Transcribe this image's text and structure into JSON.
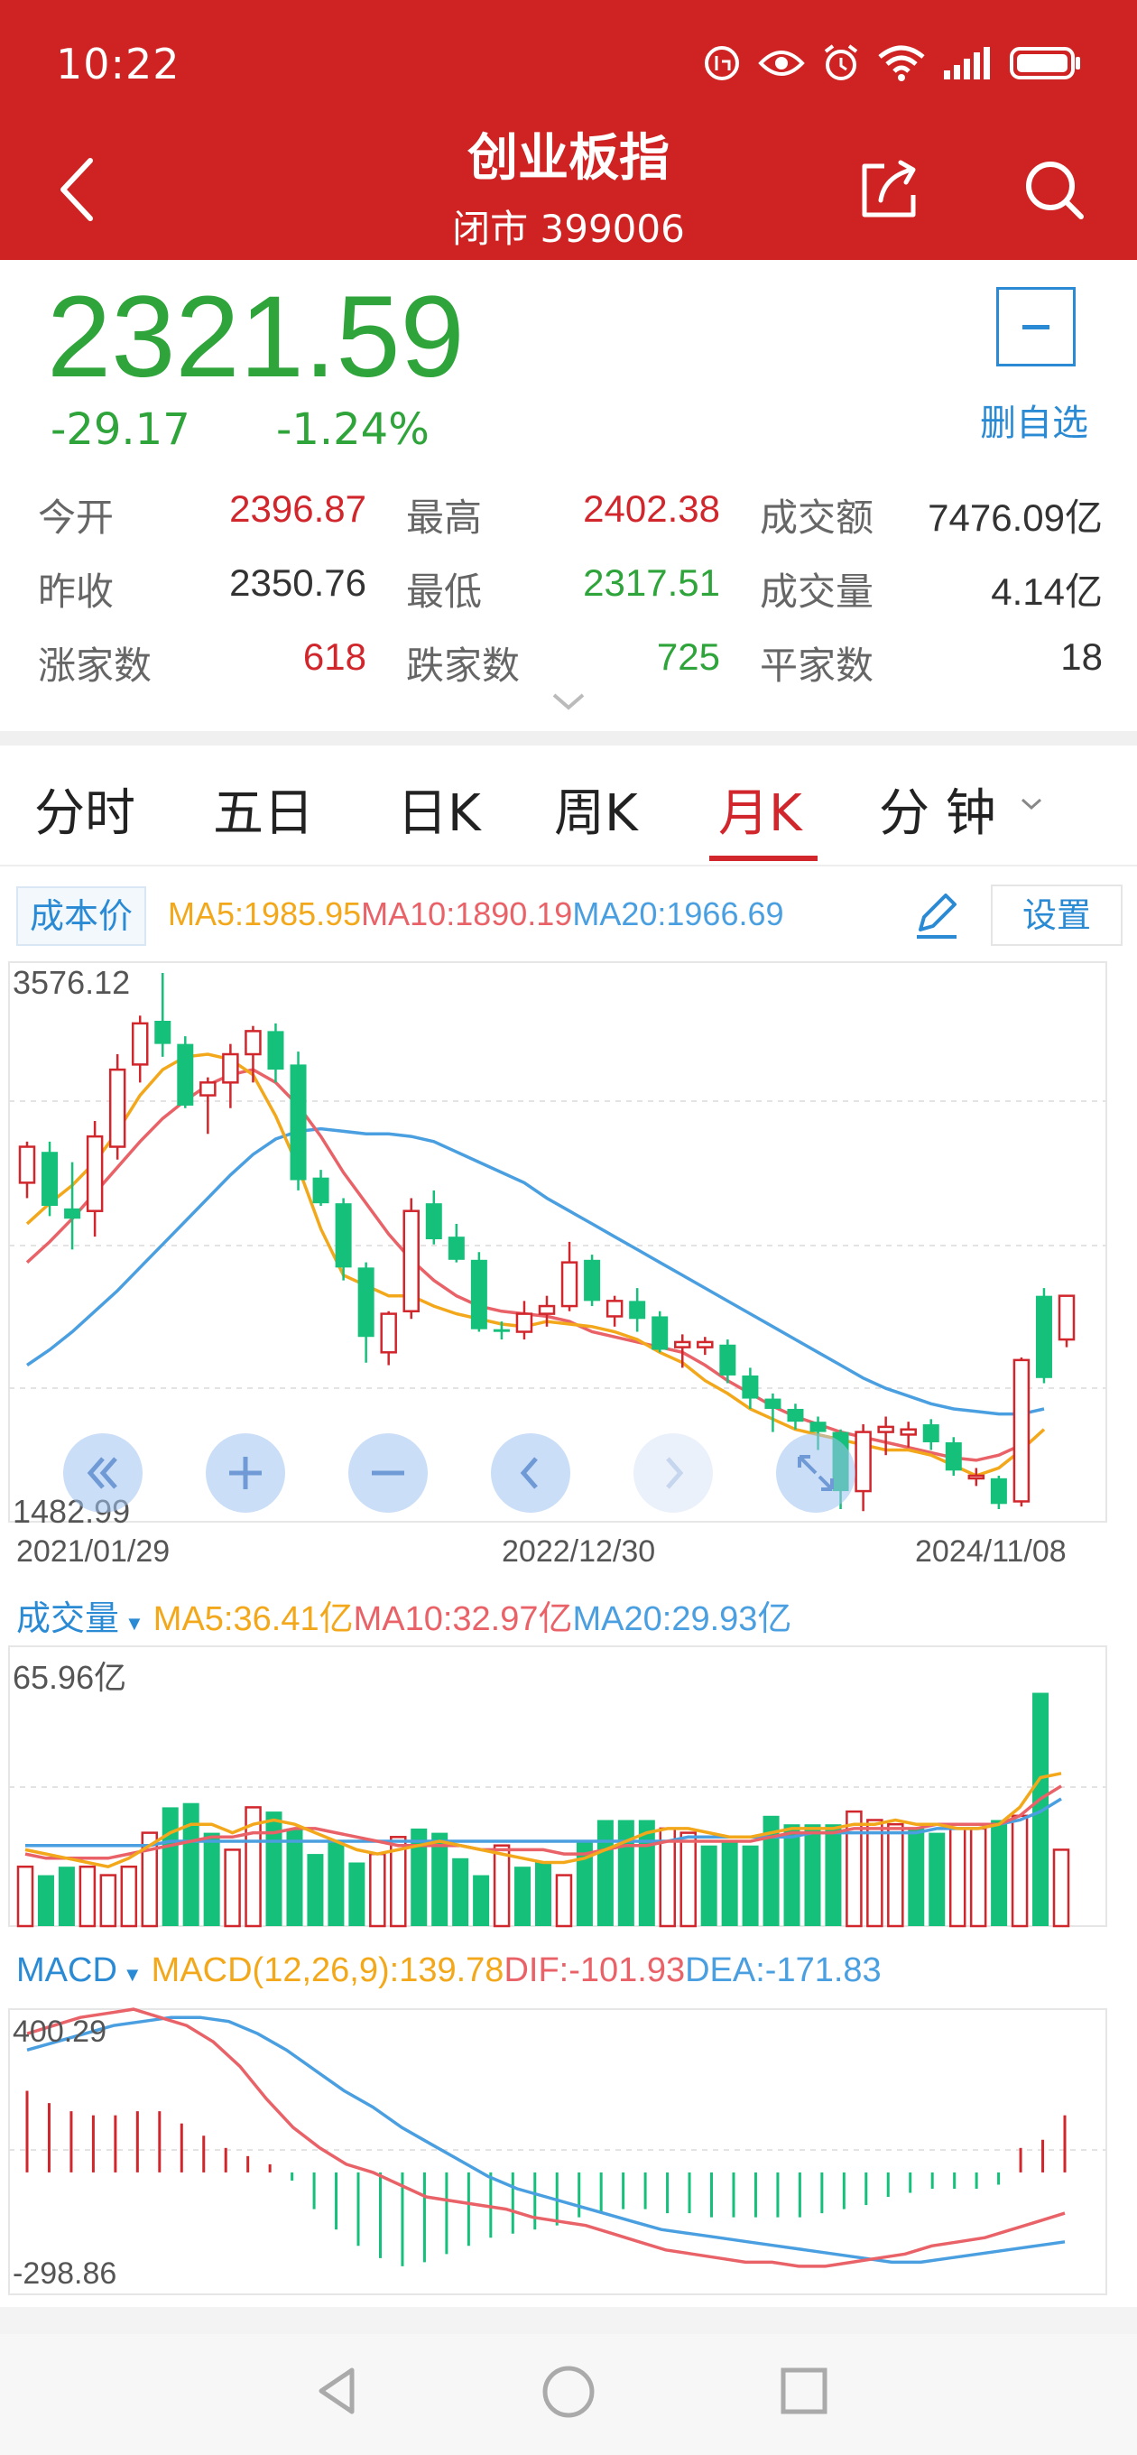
{
  "status_bar": {
    "time": "10:22"
  },
  "header": {
    "title": "创业板指",
    "subtitle": "闭市 399006"
  },
  "quote": {
    "price": "2321.59",
    "change": "-29.17",
    "change_pct": "-1.24%",
    "fav_label": "删自选"
  },
  "stats": [
    {
      "label": "今开",
      "value": "2396.87",
      "color": "red"
    },
    {
      "label": "最高",
      "value": "2402.38",
      "color": "red"
    },
    {
      "label": "成交额",
      "value": "7476.09亿",
      "color": "dark"
    },
    {
      "label": "昨收",
      "value": "2350.76",
      "color": "dark"
    },
    {
      "label": "最低",
      "value": "2317.51",
      "color": "green"
    },
    {
      "label": "成交量",
      "value": "4.14亿",
      "color": "dark"
    },
    {
      "label": "涨家数",
      "value": "618",
      "color": "red"
    },
    {
      "label": "跌家数",
      "value": "725",
      "color": "green"
    },
    {
      "label": "平家数",
      "value": "18",
      "color": "dark"
    }
  ],
  "tabs": [
    {
      "label": "分时"
    },
    {
      "label": "五日"
    },
    {
      "label": "日K"
    },
    {
      "label": "周K"
    },
    {
      "label": "月K",
      "active": true
    },
    {
      "label": "分 钟"
    }
  ],
  "main_chart": {
    "cost_chip": "成本价",
    "ma5": "MA5:1985.95",
    "ma10": "MA10:1890.19",
    "ma20": "MA20:1966.69",
    "settings": "设置",
    "y_max": "3576.12",
    "y_min": "1482.99",
    "dates": [
      "2021/01/29",
      "2022/12/30",
      "2024/11/08"
    ]
  },
  "volume_chart": {
    "title": "成交量",
    "ma5": "MA5:36.41亿",
    "ma10": "MA10:32.97亿",
    "ma20": "MA20:29.93亿",
    "y_max": "65.96亿"
  },
  "macd_chart": {
    "title": "MACD",
    "macd": "MACD(12,26,9):139.78",
    "dif": "DIF:-101.93",
    "dea": "DEA:-171.83",
    "y_max": "400.29",
    "y_min": "-298.86"
  },
  "colors": {
    "up": "#d0262c",
    "down": "#14c07a",
    "ma5": "#f2a81a",
    "ma10": "#e96268",
    "ma20": "#4a9fe0"
  },
  "chart_data": [
    {
      "type": "candlestick",
      "ylim": [
        1482.99,
        3576.12
      ],
      "ohlc": [
        [
          2900,
          2920,
          2700,
          2760,
          "up"
        ],
        [
          2880,
          2920,
          2630,
          2670,
          "down"
        ],
        [
          2660,
          2840,
          2500,
          2620,
          "down"
        ],
        [
          2650,
          3000,
          2550,
          2940,
          "up"
        ],
        [
          2900,
          3260,
          2850,
          3200,
          "up"
        ],
        [
          3220,
          3410,
          3150,
          3380,
          "up"
        ],
        [
          3390,
          3576,
          3250,
          3300,
          "down"
        ],
        [
          3300,
          3330,
          3050,
          3060,
          "down"
        ],
        [
          3100,
          3170,
          2950,
          3150,
          "up"
        ],
        [
          3150,
          3300,
          3050,
          3260,
          "up"
        ],
        [
          3260,
          3370,
          3150,
          3350,
          "up"
        ],
        [
          3350,
          3380,
          3150,
          3200,
          "down"
        ],
        [
          3220,
          3270,
          2730,
          2770,
          "down"
        ],
        [
          2780,
          2810,
          2670,
          2680,
          "down"
        ],
        [
          2680,
          2700,
          2380,
          2430,
          "down"
        ],
        [
          2430,
          2450,
          2060,
          2160,
          "down"
        ],
        [
          2100,
          2260,
          2050,
          2250,
          "up"
        ],
        [
          2260,
          2700,
          2230,
          2650,
          "up"
        ],
        [
          2680,
          2730,
          2520,
          2540,
          "down"
        ],
        [
          2550,
          2600,
          2450,
          2460,
          "down"
        ],
        [
          2460,
          2490,
          2180,
          2190,
          "down"
        ],
        [
          2190,
          2220,
          2150,
          2180,
          "down"
        ],
        [
          2180,
          2300,
          2150,
          2250,
          "up"
        ],
        [
          2250,
          2320,
          2200,
          2280,
          "up"
        ],
        [
          2280,
          2530,
          2260,
          2450,
          "up"
        ],
        [
          2460,
          2480,
          2280,
          2300,
          "down"
        ],
        [
          2300,
          2320,
          2200,
          2240,
          "up"
        ],
        [
          2300,
          2350,
          2180,
          2230,
          "down"
        ],
        [
          2240,
          2260,
          2100,
          2110,
          "down"
        ],
        [
          2120,
          2170,
          2040,
          2140,
          "up"
        ],
        [
          2140,
          2160,
          2090,
          2120,
          "up"
        ],
        [
          2130,
          2150,
          1980,
          2010,
          "down"
        ],
        [
          2010,
          2040,
          1880,
          1920,
          "down"
        ],
        [
          1920,
          1940,
          1790,
          1880,
          "down"
        ],
        [
          1880,
          1900,
          1800,
          1830,
          "down"
        ],
        [
          1830,
          1850,
          1720,
          1790,
          "down"
        ],
        [
          1790,
          1800,
          1490,
          1560,
          "down"
        ],
        [
          1560,
          1820,
          1482,
          1790,
          "up"
        ],
        [
          1790,
          1850,
          1700,
          1810,
          "up"
        ],
        [
          1800,
          1830,
          1730,
          1780,
          "up"
        ],
        [
          1820,
          1840,
          1720,
          1750,
          "down"
        ],
        [
          1750,
          1770,
          1620,
          1640,
          "down"
        ],
        [
          1620,
          1650,
          1580,
          1610,
          "up"
        ],
        [
          1610,
          1620,
          1490,
          1510,
          "down"
        ],
        [
          1520,
          2080,
          1500,
          2070,
          "up"
        ],
        [
          2320,
          2350,
          1980,
          2000,
          "down"
        ],
        [
          2150,
          2300,
          2120,
          2320,
          "up"
        ]
      ],
      "ma5": [
        2600,
        2680,
        2750,
        2840,
        2960,
        3100,
        3200,
        3250,
        3260,
        3240,
        3180,
        3020,
        2820,
        2580,
        2400,
        2360,
        2320,
        2320,
        2280,
        2250,
        2230,
        2210,
        2200,
        2220,
        2210,
        2200,
        2180,
        2150,
        2100,
        2060,
        1990,
        1940,
        1880,
        1840,
        1800,
        1780,
        1760,
        1740,
        1720,
        1720,
        1700,
        1660,
        1620,
        1650,
        1720,
        1800
      ],
      "ma10": [
        2450,
        2530,
        2620,
        2720,
        2820,
        2920,
        3010,
        3080,
        3140,
        3180,
        3200,
        3150,
        3060,
        2940,
        2800,
        2680,
        2560,
        2460,
        2380,
        2320,
        2280,
        2260,
        2250,
        2240,
        2220,
        2180,
        2160,
        2140,
        2120,
        2100,
        2050,
        1990,
        1940,
        1890,
        1850,
        1820,
        1790,
        1770,
        1750,
        1730,
        1710,
        1690,
        1680,
        1700,
        1740
      ],
      "ma20": [
        2050,
        2110,
        2180,
        2260,
        2340,
        2430,
        2520,
        2610,
        2700,
        2790,
        2870,
        2930,
        2960,
        2970,
        2960,
        2950,
        2950,
        2940,
        2920,
        2880,
        2840,
        2800,
        2760,
        2700,
        2650,
        2600,
        2550,
        2500,
        2450,
        2400,
        2350,
        2300,
        2250,
        2200,
        2150,
        2100,
        2050,
        2000,
        1960,
        1930,
        1900,
        1880,
        1870,
        1860,
        1860,
        1880
      ]
    },
    {
      "type": "bar",
      "title": "成交量",
      "ylim": [
        0,
        65.96
      ],
      "values": [
        [
          14,
          "up"
        ],
        [
          12,
          "down"
        ],
        [
          14,
          "down"
        ],
        [
          14,
          "up"
        ],
        [
          12,
          "up"
        ],
        [
          14,
          "up"
        ],
        [
          22,
          "up"
        ],
        [
          28,
          "down"
        ],
        [
          29,
          "down"
        ],
        [
          22,
          "down"
        ],
        [
          18,
          "up"
        ],
        [
          28,
          "up"
        ],
        [
          27,
          "down"
        ],
        [
          23,
          "down"
        ],
        [
          17,
          "down"
        ],
        [
          20,
          "down"
        ],
        [
          15,
          "down"
        ],
        [
          17,
          "up"
        ],
        [
          21,
          "up"
        ],
        [
          23,
          "down"
        ],
        [
          22,
          "down"
        ],
        [
          16,
          "down"
        ],
        [
          12,
          "down"
        ],
        [
          19,
          "up"
        ],
        [
          14,
          "down"
        ],
        [
          15,
          "down"
        ],
        [
          12,
          "up"
        ],
        [
          20,
          "down"
        ],
        [
          25,
          "down"
        ],
        [
          25,
          "down"
        ],
        [
          25,
          "down"
        ],
        [
          23,
          "up"
        ],
        [
          22,
          "up"
        ],
        [
          19,
          "down"
        ],
        [
          20,
          "down"
        ],
        [
          19,
          "down"
        ],
        [
          26,
          "down"
        ],
        [
          24,
          "down"
        ],
        [
          24,
          "down"
        ],
        [
          24,
          "down"
        ],
        [
          27,
          "up"
        ],
        [
          25,
          "up"
        ],
        [
          24,
          "up"
        ],
        [
          23,
          "down"
        ],
        [
          22,
          "down"
        ],
        [
          23,
          "up"
        ],
        [
          23,
          "up"
        ],
        [
          25,
          "down"
        ],
        [
          26,
          "up"
        ],
        [
          55,
          "down"
        ],
        [
          18,
          "up"
        ]
      ],
      "ma5": [
        18,
        17,
        16,
        15,
        14,
        16,
        19,
        22,
        24,
        24,
        22,
        24,
        25,
        24,
        22,
        20,
        18,
        17,
        18,
        19,
        20,
        19,
        18,
        17,
        16,
        15,
        15,
        16,
        18,
        20,
        22,
        23,
        23,
        22,
        21,
        21,
        22,
        23,
        23,
        23,
        24,
        24,
        25,
        24,
        24,
        23,
        23,
        24,
        28,
        35,
        36
      ],
      "ma10": [
        17,
        16,
        16,
        16,
        16,
        17,
        18,
        19,
        20,
        21,
        21,
        22,
        22,
        23,
        23,
        22,
        21,
        20,
        19,
        19,
        19,
        19,
        18,
        18,
        18,
        18,
        17,
        17,
        18,
        19,
        19,
        20,
        20,
        20,
        20,
        20,
        21,
        22,
        22,
        22,
        23,
        23,
        23,
        23,
        24,
        24,
        24,
        24,
        26,
        30,
        33
      ],
      "ma20": [
        19,
        19,
        19,
        19,
        19,
        19,
        19,
        20,
        20,
        20,
        20,
        20,
        20,
        20,
        20,
        20,
        20,
        20,
        20,
        20,
        20,
        20,
        20,
        20,
        20,
        20,
        20,
        20,
        20,
        20,
        20,
        20,
        21,
        21,
        21,
        21,
        21,
        21,
        22,
        22,
        22,
        22,
        22,
        22,
        23,
        23,
        23,
        24,
        25,
        27,
        30
      ]
    },
    {
      "type": "bar",
      "title": "MACD",
      "ylim": [
        -298.86,
        400.29
      ],
      "macd": [
        200,
        170,
        150,
        140,
        140,
        150,
        150,
        120,
        90,
        60,
        40,
        20,
        -20,
        -90,
        -140,
        -180,
        -210,
        -230,
        -220,
        -200,
        -180,
        -160,
        -150,
        -140,
        -130,
        -110,
        -100,
        -90,
        -90,
        -100,
        -100,
        -110,
        -110,
        -110,
        -110,
        -110,
        -100,
        -90,
        -80,
        -60,
        -50,
        -40,
        -40,
        -40,
        -30,
        60,
        80,
        140
      ],
      "dif": [
        340,
        360,
        380,
        390,
        400,
        380,
        360,
        320,
        260,
        180,
        110,
        60,
        20,
        0,
        -30,
        -60,
        -70,
        -80,
        -90,
        -110,
        -120,
        -130,
        -150,
        -170,
        -190,
        -200,
        -210,
        -220,
        -220,
        -230,
        -230,
        -220,
        -210,
        -200,
        -180,
        -170,
        -160,
        -140,
        -120,
        -100
      ],
      "dea": [
        300,
        320,
        340,
        360,
        370,
        380,
        380,
        370,
        340,
        300,
        250,
        200,
        160,
        110,
        70,
        30,
        -10,
        -40,
        -60,
        -80,
        -100,
        -120,
        -140,
        -150,
        -160,
        -170,
        -180,
        -190,
        -200,
        -210,
        -220,
        -220,
        -210,
        -200,
        -190,
        -180,
        -170
      ]
    }
  ]
}
